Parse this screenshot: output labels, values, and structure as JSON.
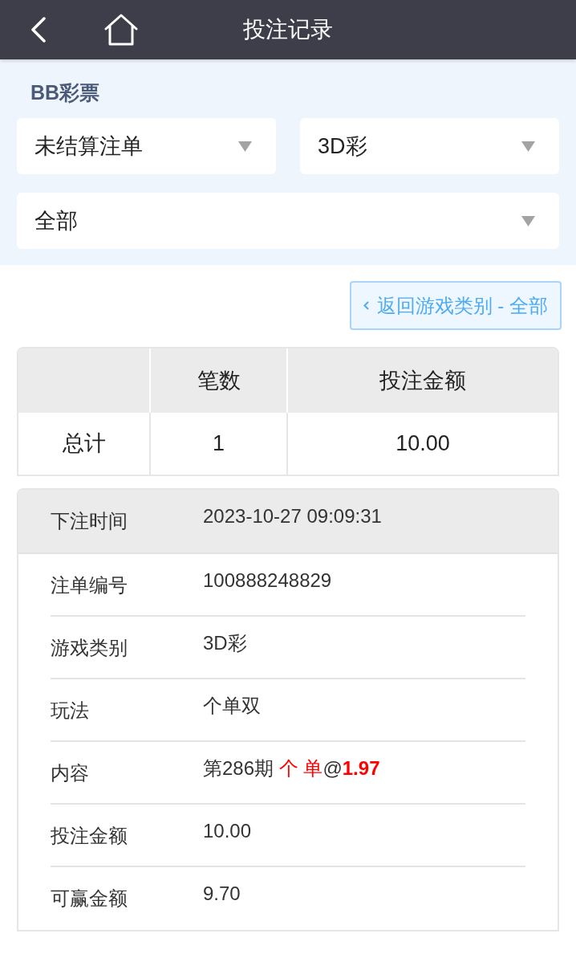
{
  "header": {
    "title": "投注记录"
  },
  "provider": {
    "name": "BB彩票"
  },
  "filter_rows": [
    [
      {
        "value": "未结算注单"
      },
      {
        "value": "3D彩"
      }
    ],
    [
      {
        "value": "全部"
      }
    ]
  ],
  "back_link": {
    "label": "返回游戏类别 - 全部"
  },
  "summary": {
    "columns": [
      "笔数",
      "投注金额"
    ],
    "rows": [
      {
        "label": "总计",
        "cells": [
          "1",
          "10.00"
        ]
      }
    ]
  },
  "details": [
    {
      "kind": "header",
      "label": "下注时间",
      "value": "2023-10-27 09:09:31"
    },
    {
      "kind": "text",
      "label": "注单编号",
      "value": "100888248829"
    },
    {
      "kind": "text",
      "label": "游戏类别",
      "value": "3D彩"
    },
    {
      "kind": "text",
      "label": "玩法",
      "value": "个单双"
    },
    {
      "kind": "parts",
      "label": "内容",
      "parts": [
        {
          "text": "第286期 ",
          "highlight": false
        },
        {
          "text": "个 单",
          "highlight": true
        },
        {
          "text": "@",
          "highlight": false
        },
        {
          "text": "**1.97**",
          "highlight": true
        }
      ]
    },
    {
      "kind": "text",
      "label": "投注金额",
      "value": "10.00"
    },
    {
      "kind": "text",
      "label": "可赢金额",
      "value": "9.70"
    }
  ]
}
